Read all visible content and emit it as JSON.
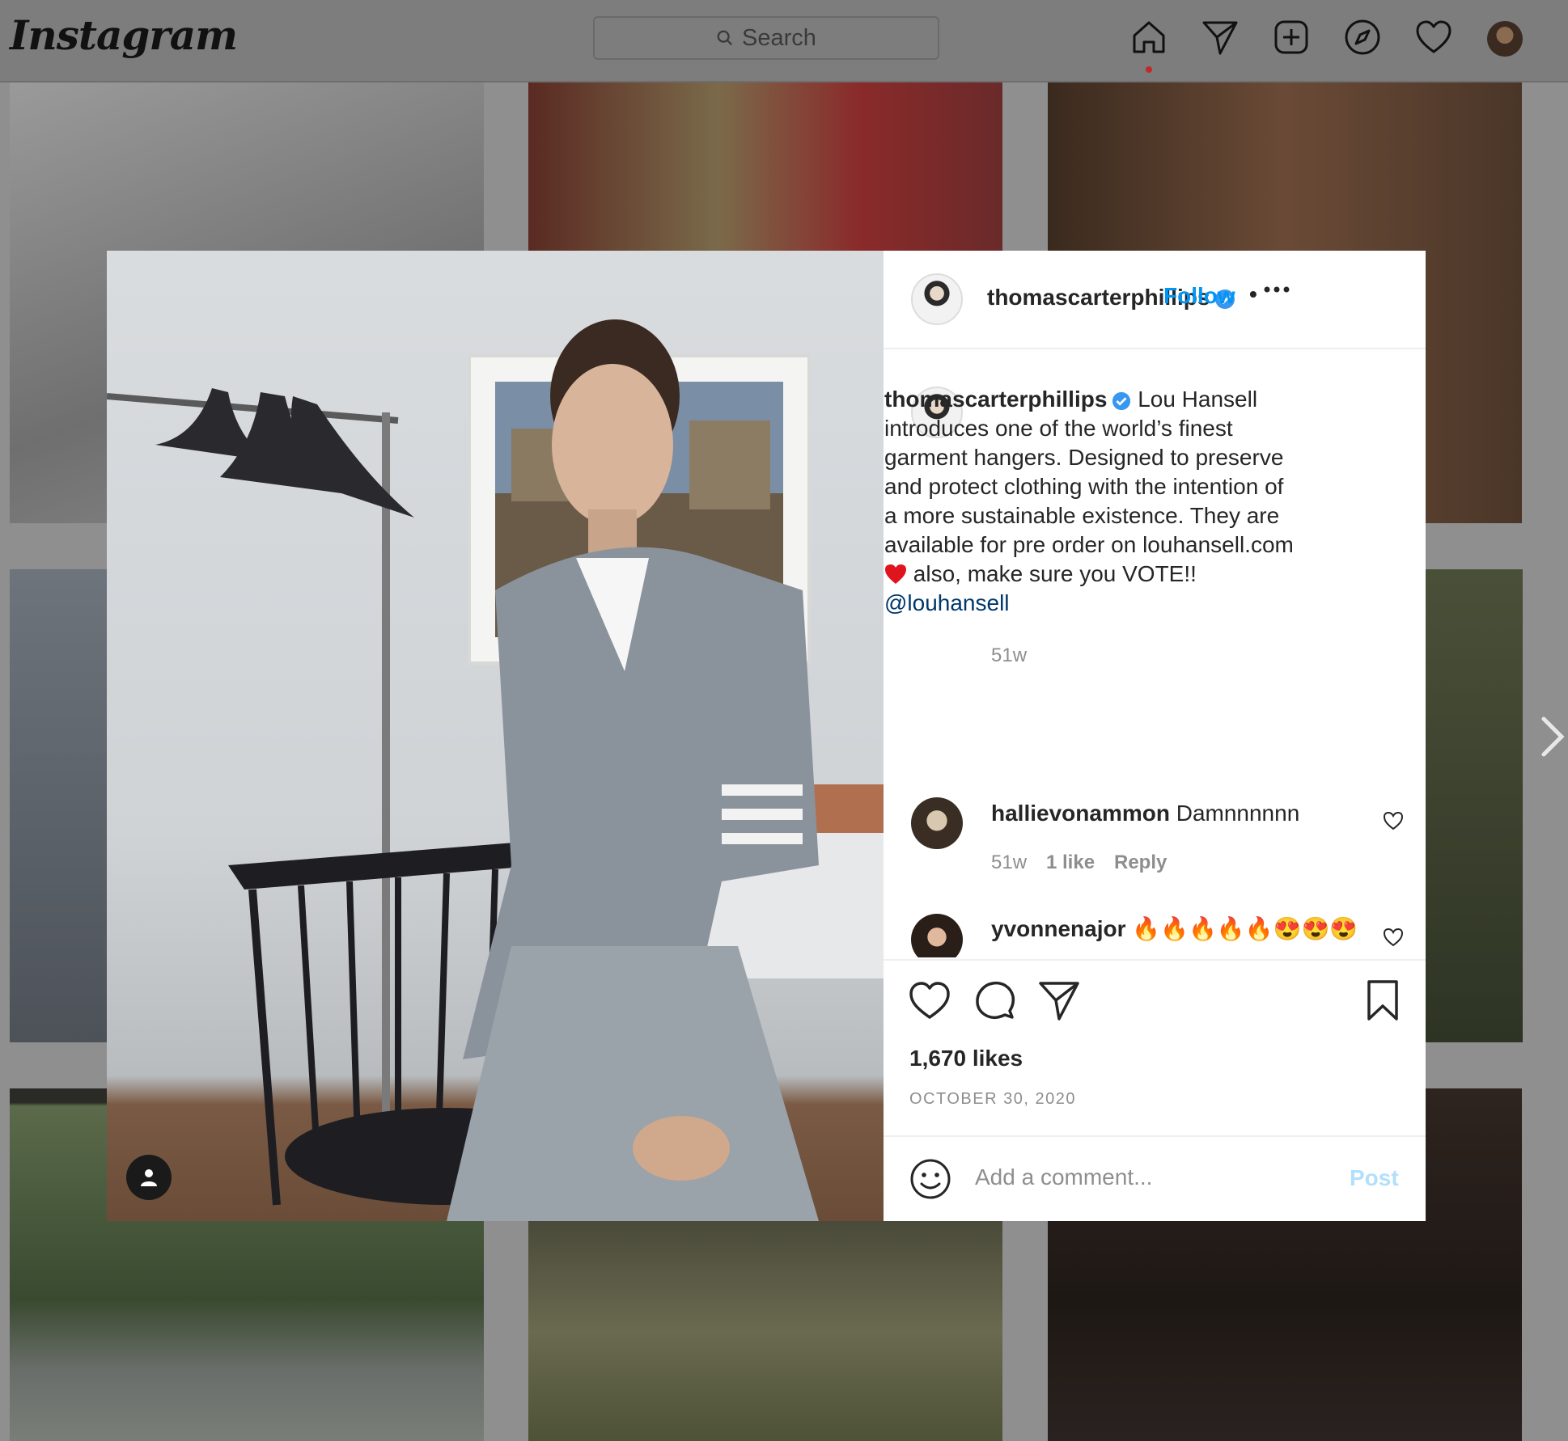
{
  "topbar": {
    "logo": "Instagram",
    "search_placeholder": "Search",
    "icons": [
      "home-icon",
      "direct-icon",
      "new-post-icon",
      "explore-icon",
      "activity-icon",
      "profile-avatar"
    ]
  },
  "post": {
    "author": "thomascarterphillips",
    "follow_label": "Follow",
    "caption_before_heart": "Lou Hansell introduces one of the world’s finest garment hangers. Designed to preserve and protect clothing with the intention of a more sustainable existence. They are available for pre order on louhansell.com ",
    "caption_after_heart": " also, make sure you VOTE!! ",
    "caption_mention": "@louhansell",
    "caption_age": "51w",
    "likes": "1,670 likes",
    "date": "OCTOBER 30, 2020"
  },
  "comments": [
    {
      "user": "hallievonammon",
      "text": "Damnnnnnn",
      "age": "51w",
      "likes": "1 like",
      "reply": "Reply"
    },
    {
      "user": "yvonnenajor",
      "text": "🔥🔥🔥🔥🔥😍😍😍"
    }
  ],
  "composer": {
    "placeholder": "Add a comment...",
    "post_label": "Post"
  },
  "colors": {
    "link_blue": "#0095f6",
    "mention_blue": "#00376b",
    "post_disabled": "#b2dffc",
    "verified": "#3897f0"
  }
}
